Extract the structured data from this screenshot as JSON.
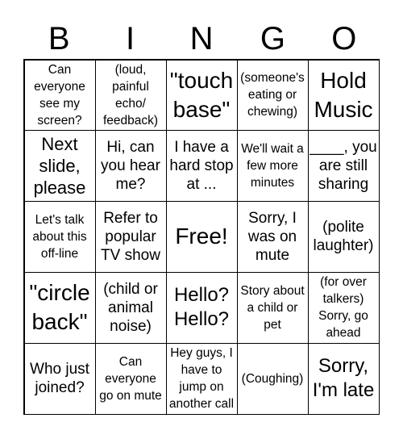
{
  "header": [
    "B",
    "I",
    "N",
    "G",
    "O"
  ],
  "cells": [
    "Can everyone see my screen?",
    "(loud, painful echo/ feedback)",
    "\"touch base\"",
    "(someone's eating or chewing)",
    "Hold Music",
    "Next slide, please",
    "Hi, can you hear me?",
    "I have a hard stop at ...",
    "We'll wait a few more minutes",
    "____, you are still sharing",
    "Let's talk about this off-line",
    "Refer to popular TV show",
    "Free!",
    "Sorry, I was on mute",
    "(polite laughter)",
    "\"circle back\"",
    "(child or animal noise)",
    "Hello? Hello?",
    "Story about a child or pet",
    "(for over talkers) Sorry, go ahead",
    "Who just joined?",
    "Can everyone go on mute",
    "Hey guys, I have to jump on another call",
    "(Coughing)",
    "Sorry, I'm late"
  ]
}
